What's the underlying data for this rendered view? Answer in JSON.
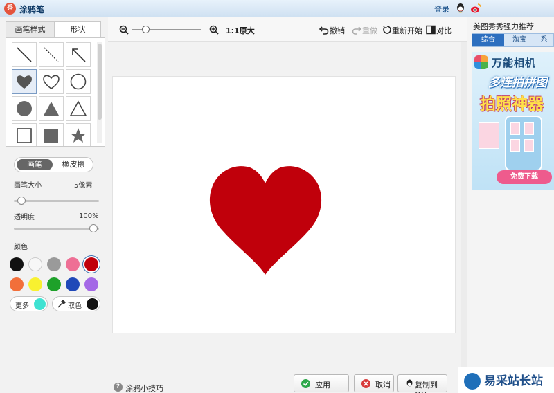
{
  "window": {
    "title": "涂鸦笔",
    "logo_text": "秀",
    "login": "登录"
  },
  "tabs": {
    "brush_style": "画笔样式",
    "shapes": "形状"
  },
  "shapes": [
    {
      "name": "line",
      "selected": false
    },
    {
      "name": "dashed-line",
      "selected": false
    },
    {
      "name": "arrow",
      "selected": false
    },
    {
      "name": "filled-heart",
      "selected": true
    },
    {
      "name": "outline-heart",
      "selected": false
    },
    {
      "name": "outline-circle",
      "selected": false
    },
    {
      "name": "filled-circle",
      "selected": false
    },
    {
      "name": "filled-triangle",
      "selected": false
    },
    {
      "name": "outline-triangle",
      "selected": false
    },
    {
      "name": "outline-square",
      "selected": false
    },
    {
      "name": "filled-square",
      "selected": false
    },
    {
      "name": "filled-star",
      "selected": false
    }
  ],
  "mode": {
    "pen": "画笔",
    "eraser": "橡皮擦",
    "active": "pen"
  },
  "brush_size": {
    "label": "画笔大小",
    "value_text": "5像素",
    "value": 5
  },
  "opacity": {
    "label": "透明度",
    "value_text": "100%",
    "value": 100
  },
  "colors": {
    "label": "颜色",
    "swatches": [
      "#111111",
      "#f7f7f7",
      "#9a9a9a",
      "#ee6f95",
      "#c0000b",
      "#f26f3a",
      "#f8f130",
      "#1ea12a",
      "#1f48b8",
      "#a468e6"
    ],
    "selected": "#c0000b",
    "more_label": "更多",
    "more_color": "#3fe2d2",
    "picker_label": "取色",
    "picker_color": "#111111"
  },
  "toolbar": {
    "zoom_label": "1:1原大",
    "undo": "撤销",
    "redo": "重做",
    "restart": "重新开始",
    "compare": "对比"
  },
  "canvas": {
    "drawn_color": "#c0000b"
  },
  "bottom": {
    "tips": "涂鸦小技巧",
    "apply": "应用",
    "cancel": "取消",
    "copy_qq": "复制到QQ"
  },
  "right_panel": {
    "title": "美图秀秀强力推荐",
    "tabs": [
      "综合",
      "淘宝",
      "系"
    ],
    "active_tab": 0,
    "ad": {
      "brand": "万能相机",
      "line1": "多连拍拼图",
      "line2": "拍照神器",
      "download": "免费下载"
    }
  },
  "watermark": {
    "text": "易采站长站"
  }
}
